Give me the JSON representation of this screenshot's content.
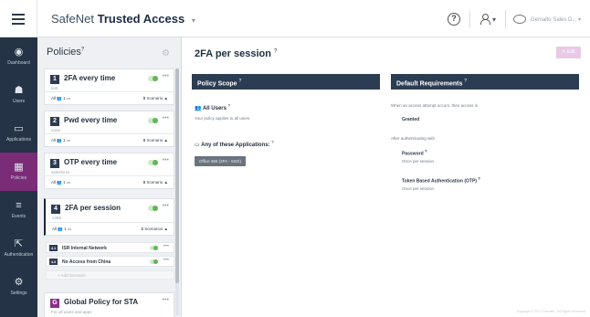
{
  "app": {
    "brand_prefix": "SafeNet",
    "brand_name": "Trusted Access",
    "brand_caret": "▾"
  },
  "topbar": {
    "help_icon": "?",
    "user_caret": "▾",
    "account_name": "Gemalto Sales D... ▾"
  },
  "nav": [
    {
      "icon": "◉",
      "label": "Dashboard"
    },
    {
      "icon": "☗",
      "label": "Users"
    },
    {
      "icon": "▭",
      "label": "Applications"
    },
    {
      "icon": "▦",
      "label": "Policies"
    },
    {
      "icon": "≡",
      "label": "Events"
    },
    {
      "icon": "⇱",
      "label": "Authentication"
    },
    {
      "icon": "⚙",
      "label": "Settings"
    }
  ],
  "policies_panel": {
    "title": "Policies",
    "title_sup": "?",
    "cards": [
      {
        "num": "1",
        "title": "2FA every time",
        "sub": "test",
        "footer_left": "All 👥 1 ▭",
        "footer_count": "0",
        "footer_right": " Scenario ▲"
      },
      {
        "num": "2",
        "title": "Pwd every time",
        "sub": "none",
        "footer_left": "All 👥 1 ▭",
        "footer_count": "0",
        "footer_right": " Scenario ▲"
      },
      {
        "num": "3",
        "title": "OTP every time",
        "sub": "salesforce",
        "footer_left": "All 👥 1 ▭",
        "footer_count": "0",
        "footer_right": " Scenario ▲"
      },
      {
        "num": "4",
        "title": "2FA per session",
        "sub": "o365",
        "footer_left": "All 👥 1 ▭",
        "footer_count": "2",
        "footer_right": " Scenarios ▲"
      }
    ],
    "scenarios": [
      {
        "num": "4.1",
        "label": "ISR Internal Network"
      },
      {
        "num": "4.2",
        "label": "No Access from China"
      }
    ],
    "add_scenario": "+ Add Scenario",
    "global": {
      "title": "Global Policy for STA",
      "sub": "For all users and apps"
    }
  },
  "main": {
    "title": "2FA per session",
    "title_sup": "?",
    "edit_label": "✎ Edit",
    "scope": {
      "header": "Policy Scope",
      "header_sup": "?",
      "users_title": "All Users",
      "users_sup": "?",
      "users_desc": "Your policy applies to all users.",
      "apps_title": "Any of these Applications:",
      "apps_sup": "?",
      "app_chip": "Office 365 (2FA - SSO)"
    },
    "requirements": {
      "header": "Default Requirements",
      "header_sup": "?",
      "attempt_text": "When an access attempt occurs, then access is",
      "attempt_value": "Granted",
      "after_text": "After authenticating with",
      "password_title": "Password",
      "password_sup": "?",
      "password_desc": "Once per session",
      "token_title": "Token Based Authentication (OTP)",
      "token_sup": "?",
      "token_desc": "Once per session"
    },
    "copyright": "Copyright © 2017 Gemalto - All Rights Reserved"
  }
}
